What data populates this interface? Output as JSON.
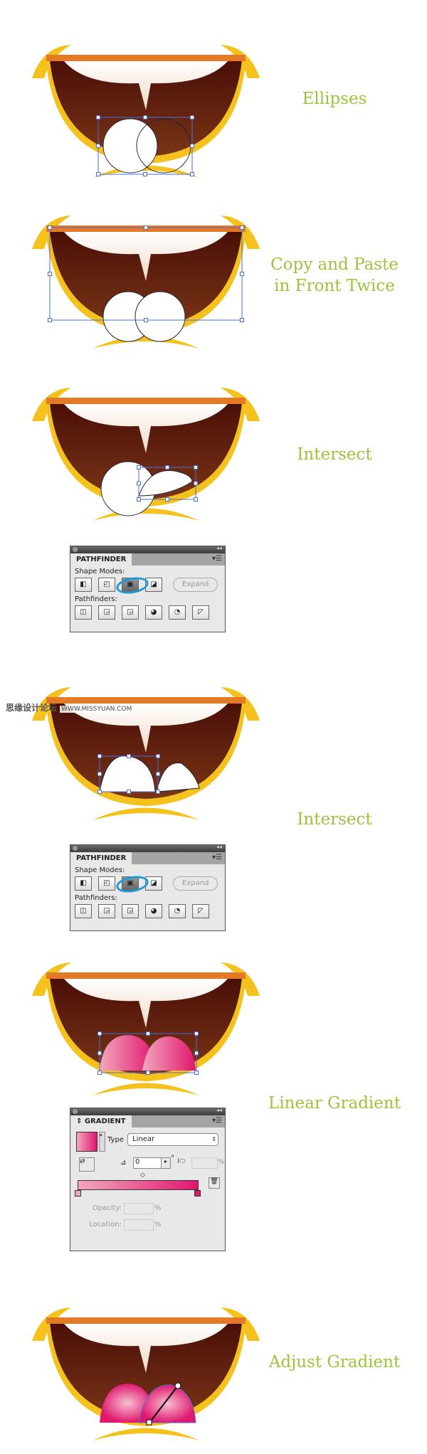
{
  "steps": [
    {
      "label": "Ellipses",
      "overlay": "ellipses"
    },
    {
      "label": "Copy and Paste in Front Twice",
      "overlay": "copy"
    },
    {
      "label": "Intersect",
      "overlay": "intersect1"
    },
    {
      "label": "Intersect",
      "overlay": "intersect2"
    },
    {
      "label": "Linear Gradient",
      "overlay": "gradient"
    },
    {
      "label": "Adjust Gradient",
      "overlay": "adjust"
    }
  ],
  "watermark": {
    "chinese": "思缘设计论坛",
    "url": "WWW.MISSYUAN.COM"
  },
  "pathfinder": {
    "title": "PATHFINDER",
    "shape_modes": "Shape Modes:",
    "pathfinders": "Pathfinders:",
    "expand": "Expand",
    "selected": "Intersect"
  },
  "gradient_panel": {
    "title": "GRADIENT",
    "type_label": "Type",
    "type_value": "Linear",
    "angle": "0",
    "opacity_label": "Opacity:",
    "location_label": "Location:",
    "percent": "%",
    "degree": "°",
    "start_color": "#f2a7bd",
    "end_color": "#e0176f"
  },
  "colors": {
    "mouth_dark": "#4a0f08",
    "mouth_light": "#7a3516",
    "lip": "#e57a26",
    "gold": "#f5c11c",
    "label": "#9cc33b",
    "select": "#4a6ee0",
    "highlight": "#1e9ad6"
  }
}
